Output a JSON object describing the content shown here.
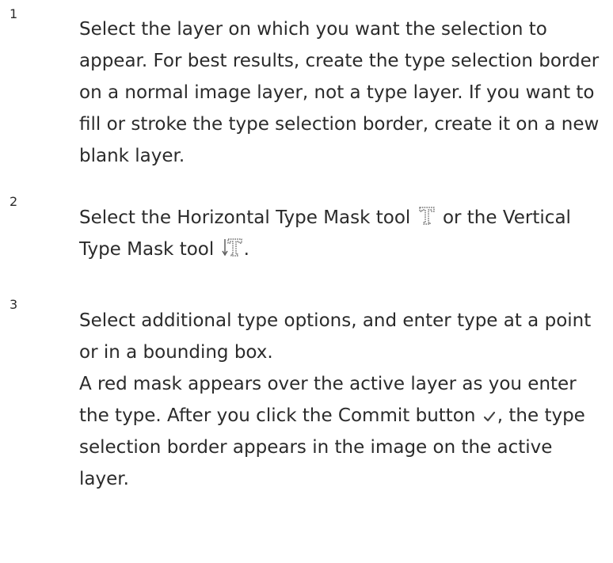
{
  "steps": [
    {
      "number": "1",
      "text": "Select the layer on which you want the selection to appear. For best results, create the type selection border on a normal image layer, not a type layer. If you want to fill or stroke the type selection border, create it on a new blank layer."
    },
    {
      "number": "2",
      "text_before_icon1": "Select the Horizontal Type Mask tool",
      "text_between_icons": "or the Vertical Type Mask tool",
      "text_after_icon2": ".",
      "icons": [
        "horizontal-type-mask-icon",
        "vertical-type-mask-icon"
      ]
    },
    {
      "number": "3",
      "text": "Select additional type options, and enter type at a point or in a bounding box.",
      "note_before_icon": "A red mask appears over the active layer as you enter the type. After you click the Commit button",
      "note_after_icon": ", the type selection border appears in the image on the active layer.",
      "icons": [
        "checkmark-icon"
      ]
    }
  ]
}
